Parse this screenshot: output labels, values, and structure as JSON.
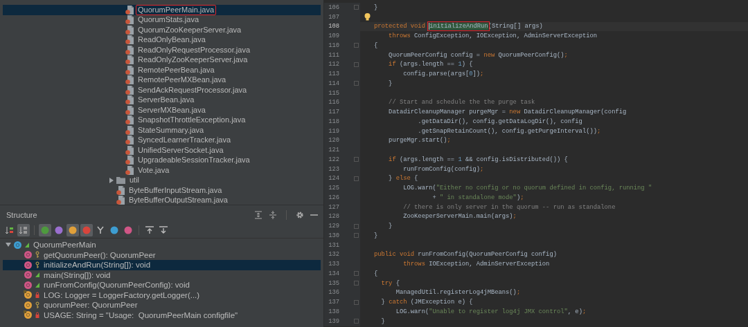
{
  "project_tree": {
    "items": [
      {
        "kind": "group",
        "children": [
          {
            "kind": "java",
            "label": "QuorumPeerMain.java",
            "selected": true,
            "boxed": true
          },
          {
            "kind": "java",
            "label": "QuorumStats.java",
            "selected": false,
            "boxed": false
          },
          {
            "kind": "java",
            "label": "QuorumZooKeeperServer.java",
            "selected": false,
            "boxed": false
          },
          {
            "kind": "java",
            "label": "ReadOnlyBean.java",
            "selected": false,
            "boxed": false
          },
          {
            "kind": "java",
            "label": "ReadOnlyRequestProcessor.java",
            "selected": false,
            "boxed": false
          },
          {
            "kind": "java",
            "label": "ReadOnlyZooKeeperServer.java",
            "selected": false,
            "boxed": false
          },
          {
            "kind": "java",
            "label": "RemotePeerBean.java",
            "selected": false,
            "boxed": false
          },
          {
            "kind": "java",
            "label": "RemotePeerMXBean.java",
            "selected": false,
            "boxed": false
          },
          {
            "kind": "java",
            "label": "SendAckRequestProcessor.java",
            "selected": false,
            "boxed": false
          },
          {
            "kind": "java",
            "label": "ServerBean.java",
            "selected": false,
            "boxed": false
          },
          {
            "kind": "java",
            "label": "ServerMXBean.java",
            "selected": false,
            "boxed": false
          },
          {
            "kind": "java",
            "label": "SnapshotThrottleException.java",
            "selected": false,
            "boxed": false
          },
          {
            "kind": "java",
            "label": "StateSummary.java",
            "selected": false,
            "boxed": false
          },
          {
            "kind": "java",
            "label": "SyncedLearnerTracker.java",
            "selected": false,
            "boxed": false
          },
          {
            "kind": "java",
            "label": "UnifiedServerSocket.java",
            "selected": false,
            "boxed": false
          },
          {
            "kind": "java",
            "label": "UpgradeableSessionTracker.java",
            "selected": false,
            "boxed": false
          },
          {
            "kind": "java",
            "label": "Vote.java",
            "selected": false,
            "boxed": false
          }
        ]
      },
      {
        "kind": "folder",
        "label": "util",
        "expanded": false,
        "selected": false,
        "boxed": false
      },
      {
        "kind": "java",
        "label": "ByteBufferInputStream.java",
        "selected": false,
        "boxed": false
      },
      {
        "kind": "java",
        "label": "ByteBufferOutputStream.java",
        "selected": false,
        "boxed": false
      }
    ]
  },
  "structure": {
    "title": "Structure",
    "toolbar": [
      [
        {
          "kind": "sort",
          "on": false
        },
        {
          "kind": "sort-alpha",
          "on": true
        }
      ],
      [
        {
          "kind": "circle",
          "color": "#4e9a3e",
          "on": true
        },
        {
          "kind": "circle",
          "color": "#9a6fcf",
          "on": false
        },
        {
          "kind": "circle",
          "color": "#e0a03a",
          "on": true
        },
        {
          "kind": "circle",
          "color": "#d8453c",
          "on": true
        },
        {
          "kind": "fork",
          "on": false
        },
        {
          "kind": "circle",
          "color": "#3d9dd1",
          "on": false
        },
        {
          "kind": "circle",
          "color": "#d05686",
          "on": false
        }
      ],
      [
        {
          "kind": "expand",
          "on": false
        },
        {
          "kind": "collapse",
          "on": false
        }
      ]
    ],
    "root": {
      "label": "QuorumPeerMain",
      "expanded": true,
      "children": [
        {
          "kind": "protected-method",
          "static": false,
          "label": "getQuorumPeer(): QuorumPeer",
          "selected": false
        },
        {
          "kind": "protected-method",
          "static": false,
          "label": "initializeAndRun(String[]): void",
          "selected": true
        },
        {
          "kind": "public-method",
          "static": false,
          "label": "main(String[]): void",
          "selected": false
        },
        {
          "kind": "public-method",
          "static": false,
          "label": "runFromConfig(QuorumPeerConfig): void",
          "selected": false
        },
        {
          "kind": "private-field",
          "static": true,
          "label": "LOG: Logger = LoggerFactory.getLogger(...)",
          "selected": false
        },
        {
          "kind": "protected-field",
          "static": false,
          "label": "quorumPeer: QuorumPeer",
          "selected": false
        },
        {
          "kind": "private-field",
          "static": true,
          "label": "USAGE: String = \"Usage:  QuorumPeerMain configfile\"",
          "selected": false
        }
      ]
    }
  },
  "editor": {
    "lines": [
      {
        "number": "106",
        "kind": "fold",
        "current": false,
        "tokens": [
          {
            "kind": "plain",
            "text": "}"
          }
        ]
      },
      {
        "number": "107",
        "kind": "bulb",
        "current": false
      },
      {
        "number": "108",
        "kind": "plain",
        "current": true,
        "tokens": [
          {
            "kind": "kw",
            "text": "protected void "
          },
          {
            "kind": "found",
            "text": "initializeAndRun"
          },
          {
            "kind": "plain",
            "text": "(String[] args)"
          }
        ]
      },
      {
        "number": "109",
        "kind": "plain",
        "current": false,
        "tokens": [
          {
            "kind": "kw",
            "text": "    throws"
          },
          {
            "kind": "plain",
            "text": " ConfigException, IOException, AdminServerException"
          }
        ]
      },
      {
        "number": "110",
        "kind": "fold",
        "current": false,
        "tokens": [
          {
            "kind": "plain",
            "text": "{"
          }
        ]
      },
      {
        "number": "111",
        "kind": "plain",
        "current": false,
        "tokens": [
          {
            "kind": "plain",
            "text": "    QuorumPeerConfig config = "
          },
          {
            "kind": "kw",
            "text": "new"
          },
          {
            "kind": "plain",
            "text": " QuorumPeerConfig()"
          },
          {
            "kind": "kw",
            "text": ";"
          }
        ]
      },
      {
        "number": "112",
        "kind": "fold",
        "current": false,
        "tokens": [
          {
            "kind": "kw",
            "text": "    if"
          },
          {
            "kind": "plain",
            "text": " (args.length == "
          },
          {
            "kind": "num",
            "text": "1"
          },
          {
            "kind": "plain",
            "text": ") {"
          }
        ]
      },
      {
        "number": "113",
        "kind": "plain",
        "current": false,
        "tokens": [
          {
            "kind": "plain",
            "text": "        config.parse(args["
          },
          {
            "kind": "num",
            "text": "0"
          },
          {
            "kind": "plain",
            "text": "])"
          },
          {
            "kind": "kw",
            "text": ";"
          }
        ]
      },
      {
        "number": "114",
        "kind": "fold",
        "current": false,
        "tokens": [
          {
            "kind": "plain",
            "text": "    }"
          }
        ]
      },
      {
        "number": "115",
        "kind": "plain",
        "current": false
      },
      {
        "number": "116",
        "kind": "plain",
        "current": false,
        "tokens": [
          {
            "kind": "cm",
            "text": "    // Start and schedule the the purge task"
          }
        ]
      },
      {
        "number": "117",
        "kind": "plain",
        "current": false,
        "tokens": [
          {
            "kind": "plain",
            "text": "    DatadirCleanupManager purgeMgr = "
          },
          {
            "kind": "kw",
            "text": "new"
          },
          {
            "kind": "plain",
            "text": " DatadirCleanupManager(config"
          }
        ]
      },
      {
        "number": "118",
        "kind": "plain",
        "current": false,
        "tokens": [
          {
            "kind": "plain",
            "text": "            .getDataDir(), config.getDataLogDir(), config"
          }
        ]
      },
      {
        "number": "119",
        "kind": "plain",
        "current": false,
        "tokens": [
          {
            "kind": "plain",
            "text": "            .getSnapRetainCount(), config.getPurgeInterval())"
          },
          {
            "kind": "kw",
            "text": ";"
          }
        ]
      },
      {
        "number": "120",
        "kind": "plain",
        "current": false,
        "tokens": [
          {
            "kind": "plain",
            "text": "    purgeMgr.start()"
          },
          {
            "kind": "kw",
            "text": ";"
          }
        ]
      },
      {
        "number": "121",
        "kind": "plain",
        "current": false
      },
      {
        "number": "122",
        "kind": "fold",
        "current": false,
        "tokens": [
          {
            "kind": "kw",
            "text": "    if"
          },
          {
            "kind": "plain",
            "text": " (args.length == "
          },
          {
            "kind": "num",
            "text": "1"
          },
          {
            "kind": "plain",
            "text": " && config.isDistributed()) {"
          }
        ]
      },
      {
        "number": "123",
        "kind": "plain",
        "current": false,
        "tokens": [
          {
            "kind": "plain",
            "text": "        runFromConfig(config)"
          },
          {
            "kind": "kw",
            "text": ";"
          }
        ]
      },
      {
        "number": "124",
        "kind": "fold",
        "current": false,
        "tokens": [
          {
            "kind": "plain",
            "text": "    } "
          },
          {
            "kind": "kw",
            "text": "else"
          },
          {
            "kind": "plain",
            "text": " {"
          }
        ]
      },
      {
        "number": "125",
        "kind": "plain",
        "current": false,
        "tokens": [
          {
            "kind": "plain",
            "text": "        LOG.warn("
          },
          {
            "kind": "str",
            "text": "\"Either no config or no quorum defined in config, running \""
          }
        ]
      },
      {
        "number": "126",
        "kind": "plain",
        "current": false,
        "tokens": [
          {
            "kind": "plain",
            "text": "                + "
          },
          {
            "kind": "str",
            "text": "\" in standalone mode\""
          },
          {
            "kind": "plain",
            "text": ")"
          },
          {
            "kind": "kw",
            "text": ";"
          }
        ]
      },
      {
        "number": "127",
        "kind": "plain",
        "current": false,
        "tokens": [
          {
            "kind": "cm",
            "text": "        // there is only server in the quorum -- run as standalone"
          }
        ]
      },
      {
        "number": "128",
        "kind": "plain",
        "current": false,
        "tokens": [
          {
            "kind": "plain",
            "text": "        ZooKeeperServerMain.main(args)"
          },
          {
            "kind": "kw",
            "text": ";"
          }
        ]
      },
      {
        "number": "129",
        "kind": "fold",
        "current": false,
        "tokens": [
          {
            "kind": "plain",
            "text": "    }"
          }
        ]
      },
      {
        "number": "130",
        "kind": "fold",
        "current": false,
        "tokens": [
          {
            "kind": "plain",
            "text": "}"
          }
        ]
      },
      {
        "number": "131",
        "kind": "plain",
        "current": false
      },
      {
        "number": "132",
        "kind": "plain",
        "current": false,
        "tokens": [
          {
            "kind": "kw",
            "text": "public void "
          },
          {
            "kind": "plain",
            "text": "runFromConfig(QuorumPeerConfig config)"
          }
        ]
      },
      {
        "number": "133",
        "kind": "plain",
        "current": false,
        "tokens": [
          {
            "kind": "kw",
            "text": "        throws"
          },
          {
            "kind": "plain",
            "text": " IOException, AdminServerException"
          }
        ]
      },
      {
        "number": "134",
        "kind": "fold",
        "current": false,
        "tokens": [
          {
            "kind": "plain",
            "text": "{"
          }
        ]
      },
      {
        "number": "135",
        "kind": "fold",
        "current": false,
        "tokens": [
          {
            "kind": "kw",
            "text": "  try"
          },
          {
            "kind": "plain",
            "text": " {"
          }
        ]
      },
      {
        "number": "136",
        "kind": "plain",
        "current": false,
        "tokens": [
          {
            "kind": "plain",
            "text": "      ManagedUtil.registerLog4jMBeans()"
          },
          {
            "kind": "kw",
            "text": ";"
          }
        ]
      },
      {
        "number": "137",
        "kind": "fold",
        "current": false,
        "tokens": [
          {
            "kind": "plain",
            "text": "  } "
          },
          {
            "kind": "kw",
            "text": "catch"
          },
          {
            "kind": "plain",
            "text": " (JMException e) {"
          }
        ]
      },
      {
        "number": "138",
        "kind": "plain",
        "current": false,
        "tokens": [
          {
            "kind": "plain",
            "text": "      LOG.warn("
          },
          {
            "kind": "str",
            "text": "\"Unable to register log4j JMX control\""
          },
          {
            "kind": "plain",
            "text": ", e)"
          },
          {
            "kind": "kw",
            "text": ";"
          }
        ]
      },
      {
        "number": "139",
        "kind": "fold",
        "current": false,
        "tokens": [
          {
            "kind": "plain",
            "text": "  }"
          }
        ]
      }
    ]
  }
}
